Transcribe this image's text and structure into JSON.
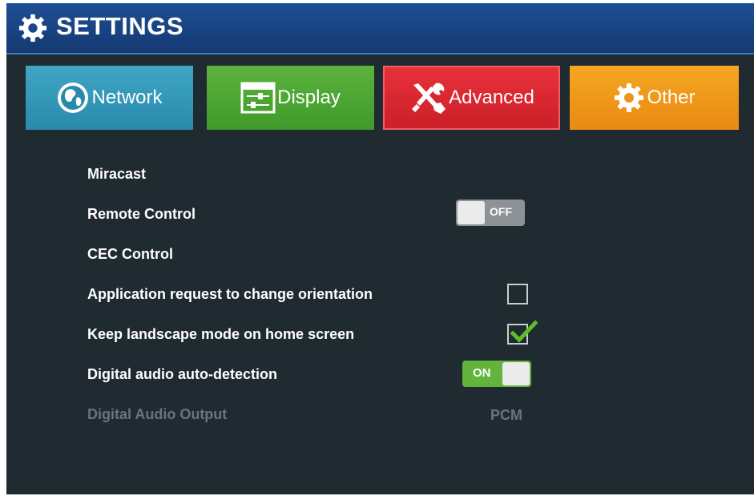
{
  "header": {
    "title": "SETTINGS",
    "icon": "gear-icon"
  },
  "tabs": [
    {
      "label": "Network",
      "icon": "globe-icon",
      "color": "#2f95b6"
    },
    {
      "label": "Display",
      "icon": "display-sliders-icon",
      "color": "#4ea634"
    },
    {
      "label": "Advanced",
      "icon": "tools-icon",
      "color": "#d8242d",
      "selected": true
    },
    {
      "label": "Other",
      "icon": "gear-icon",
      "color": "#f09a1a"
    }
  ],
  "settings": {
    "miracast": {
      "label": "Miracast"
    },
    "remote_control": {
      "label": "Remote Control",
      "toggle": "OFF",
      "enabled": false
    },
    "cec_control": {
      "label": "CEC Control"
    },
    "orientation": {
      "label": "Application request to change orientation",
      "checked": false
    },
    "landscape": {
      "label": "Keep landscape mode on home screen",
      "checked": true
    },
    "audio_detect": {
      "label": "Digital audio auto-detection",
      "toggle": "ON",
      "enabled": true
    },
    "audio_output": {
      "label": "Digital Audio Output",
      "value": "PCM",
      "disabled": true
    }
  }
}
